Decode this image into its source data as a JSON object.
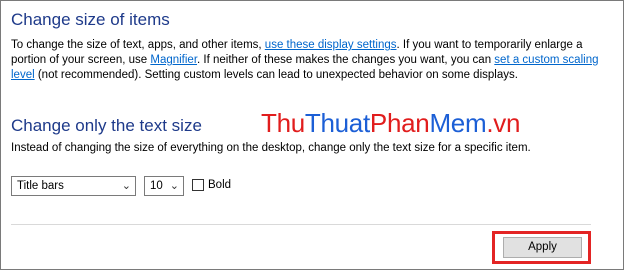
{
  "section1": {
    "title": "Change size of items",
    "p_part1": "To change the size of text, apps, and other items, ",
    "link_display": "use these display settings",
    "p_part2": ".  If you want to temporarily enlarge a portion of your screen, use ",
    "link_magnifier": "Magnifier",
    "p_part3": ".  If neither of these makes the changes you want, you can ",
    "link_custom": "set a custom scaling level",
    "p_part4": " (not recommended).  Setting custom levels can lead to unexpected behavior on some displays."
  },
  "watermark": {
    "part_thu": "Thu",
    "part_thuat": "Thuat",
    "part_phan": "Phan",
    "part_mem": "Mem",
    "part_vn": ".vn"
  },
  "section2": {
    "title": "Change only the text size",
    "description": "Instead of changing the size of everything on the desktop, change only the text size for a specific item.",
    "item_select": {
      "value": "Title bars"
    },
    "size_select": {
      "value": "10"
    },
    "bold_label": "Bold",
    "bold_checked": false
  },
  "footer": {
    "apply_label": "Apply"
  },
  "colors": {
    "heading": "#1e3a8a",
    "link": "#0066cc",
    "highlight": "#e32424"
  }
}
